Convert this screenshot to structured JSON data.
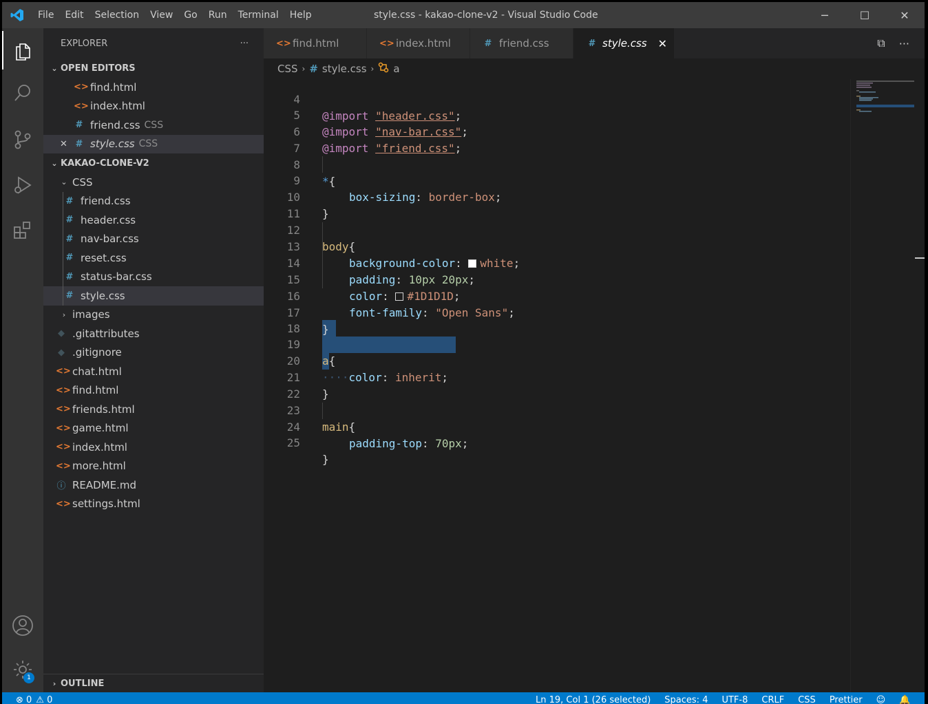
{
  "titlebar": {
    "menu": [
      "File",
      "Edit",
      "Selection",
      "View",
      "Go",
      "Run",
      "Terminal",
      "Help"
    ],
    "title": "style.css - kakao-clone-v2 - Visual Studio Code",
    "controls": [
      "─",
      "☐",
      "✕"
    ]
  },
  "activity": {
    "icons": [
      "explorer-icon",
      "search-icon",
      "source-control-icon",
      "run-debug-icon",
      "extensions-icon",
      "account-icon",
      "settings-gear-icon"
    ],
    "settings_badge": "1"
  },
  "sidebar": {
    "header": "EXPLORER",
    "more": "···",
    "open_editors_title": "OPEN EDITORS",
    "open_editors": [
      {
        "icon": "<>",
        "type": "html",
        "name": "find.html",
        "desc": ""
      },
      {
        "icon": "<>",
        "type": "html",
        "name": "index.html",
        "desc": ""
      },
      {
        "icon": "#",
        "type": "css",
        "name": "friend.css",
        "desc": "CSS"
      },
      {
        "icon": "#",
        "type": "css",
        "name": "style.css",
        "desc": "CSS"
      }
    ],
    "open_editor_close": "✕",
    "project_title": "KAKAO-CLONE-V2",
    "css_folder": "CSS",
    "css_files": [
      "friend.css",
      "header.css",
      "nav-bar.css",
      "reset.css",
      "status-bar.css",
      "style.css"
    ],
    "images_folder": "images",
    "root_files": [
      {
        "icon": "◆",
        "type": "git",
        "name": ".gitattributes"
      },
      {
        "icon": "◆",
        "type": "git",
        "name": ".gitignore"
      },
      {
        "icon": "<>",
        "type": "html",
        "name": "chat.html"
      },
      {
        "icon": "<>",
        "type": "html",
        "name": "find.html"
      },
      {
        "icon": "<>",
        "type": "html",
        "name": "friends.html"
      },
      {
        "icon": "<>",
        "type": "html",
        "name": "game.html"
      },
      {
        "icon": "<>",
        "type": "html",
        "name": "index.html"
      },
      {
        "icon": "<>",
        "type": "html",
        "name": "more.html"
      },
      {
        "icon": "ⓘ",
        "type": "info",
        "name": "README.md"
      },
      {
        "icon": "<>",
        "type": "html",
        "name": "settings.html"
      }
    ],
    "outline_title": "OUTLINE"
  },
  "tabs": [
    {
      "icon": "<>",
      "type": "html",
      "label": "find.html"
    },
    {
      "icon": "<>",
      "type": "html",
      "label": "index.html"
    },
    {
      "icon": "#",
      "type": "css",
      "label": "friend.css"
    },
    {
      "icon": "#",
      "type": "css",
      "label": "style.css",
      "close": "✕"
    }
  ],
  "tab_actions": [
    "⧉",
    "···"
  ],
  "breadcrumb": {
    "folder": "CSS",
    "file_icon": "#",
    "file": "style.css",
    "symbol": "a"
  },
  "editor": {
    "line_numbers": [
      "4",
      "5",
      "6",
      "7",
      "8",
      "9",
      "10",
      "11",
      "12",
      "13",
      "14",
      "15",
      "16",
      "17",
      "18",
      "19",
      "20",
      "21",
      "22",
      "23",
      "24",
      "25"
    ],
    "imports": [
      {
        "kw": "@import",
        "str": "\"header.css\"",
        "end": ";"
      },
      {
        "kw": "@import",
        "str": "\"nav-bar.css\"",
        "end": ";"
      },
      {
        "kw": "@import",
        "str": "\"friend.css\"",
        "end": ";"
      }
    ],
    "star_sel": "*",
    "open_brace": "{",
    "close_brace": "}",
    "box_prop": "box-sizing",
    "box_val": "border-box",
    "body_sel": "body",
    "bg_prop": "background-color",
    "bg_val": "white",
    "pad_prop": "padding",
    "pad_val": "10px 20px",
    "color_prop": "color",
    "color_val": "#1D1D1D",
    "font_prop": "font-family",
    "font_val": "\"Open Sans\"",
    "a_sel": "a",
    "a_prop": "color",
    "a_val": "inherit",
    "main_sel": "main",
    "main_prop": "padding-top",
    "main_val": "70px",
    "colon": ": ",
    "semi": ";",
    "indent_dots": "····"
  },
  "statusbar": {
    "errors": "⊗ 0",
    "warnings": "⚠ 0",
    "position": "Ln 19, Col 1 (26 selected)",
    "spaces": "Spaces: 4",
    "encoding": "UTF-8",
    "eol": "CRLF",
    "language": "CSS",
    "formatter": "Prettier"
  },
  "colors": {
    "accent": "#007acc",
    "html_icon": "#e37933",
    "css_icon": "#519aba",
    "selection": "#264f78"
  }
}
